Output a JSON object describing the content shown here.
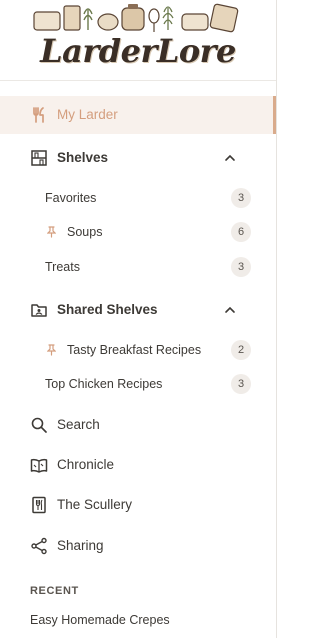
{
  "app": {
    "logo_text": "LarderLore"
  },
  "nav": {
    "my_larder": "My Larder",
    "search": "Search",
    "chronicle": "Chronicle",
    "scullery": "The Scullery",
    "sharing": "Sharing"
  },
  "shelves": {
    "title": "Shelves",
    "items": [
      {
        "label": "Favorites",
        "count": "3",
        "pinned": false
      },
      {
        "label": "Soups",
        "count": "6",
        "pinned": true
      },
      {
        "label": "Treats",
        "count": "3",
        "pinned": false
      }
    ]
  },
  "shared_shelves": {
    "title": "Shared Shelves",
    "items": [
      {
        "label": "Tasty Breakfast Recipes",
        "count": "2",
        "pinned": true
      },
      {
        "label": "Top Chicken Recipes",
        "count": "3",
        "pinned": false
      }
    ]
  },
  "recent": {
    "title": "RECENT",
    "items": [
      "Easy Homemade Crepes"
    ]
  },
  "colors": {
    "accent": "#d49e7e",
    "active_bg": "#f8f1ec",
    "text": "#3d3a36",
    "badge_bg": "#f0ece8"
  }
}
